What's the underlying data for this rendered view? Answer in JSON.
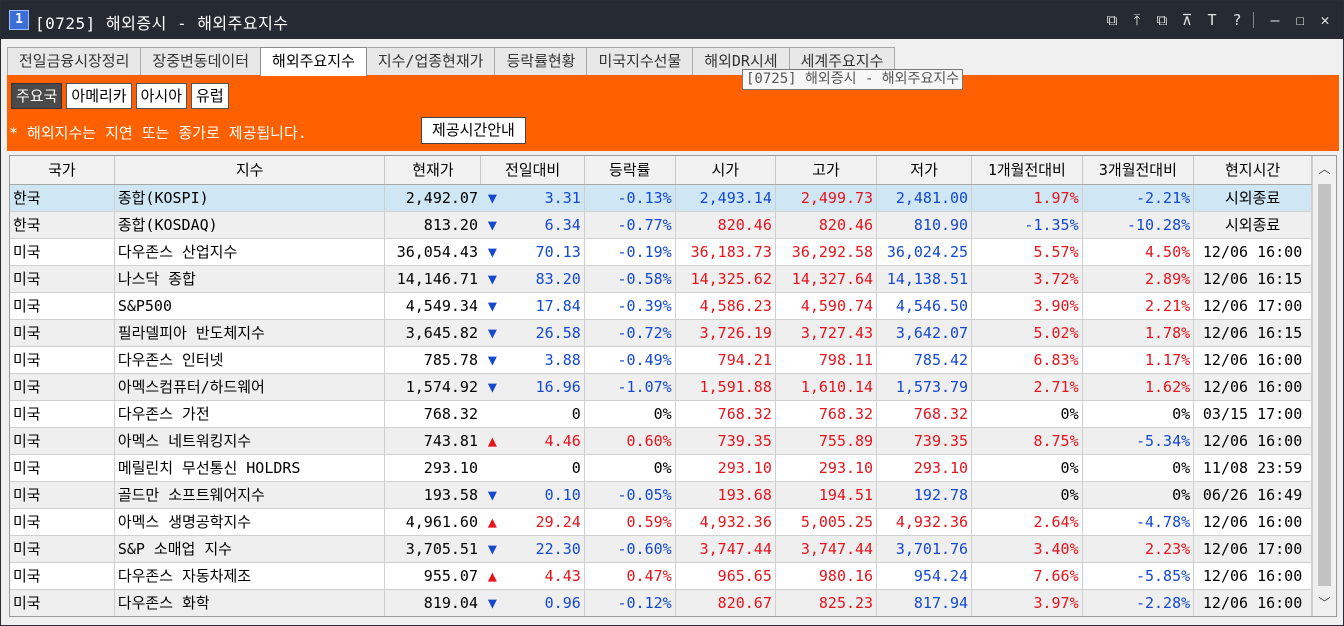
{
  "window": {
    "badge": "1",
    "title": "[0725] 해외증시 - 해외주요지수",
    "tools": [
      "⧉",
      "⤒",
      "⧉",
      "⊼",
      "T",
      "?",
      "—",
      "☐",
      "✕"
    ]
  },
  "tabs": [
    {
      "label": "전일금융시장정리",
      "active": false
    },
    {
      "label": "장중변동데이터",
      "active": false
    },
    {
      "label": "해외주요지수",
      "active": true
    },
    {
      "label": "지수/업종현재가",
      "active": false
    },
    {
      "label": "등락률현황",
      "active": false
    },
    {
      "label": "미국지수선물",
      "active": false
    },
    {
      "label": "해외DR시세",
      "active": false
    },
    {
      "label": "세계주요지수",
      "active": false
    }
  ],
  "tooltip": "[0725] 해외증시 - 해외주요지수",
  "subtabs": [
    {
      "label": "주요국",
      "active": true
    },
    {
      "label": "아메리카",
      "active": false
    },
    {
      "label": "아시아",
      "active": false
    },
    {
      "label": "유럽",
      "active": false
    }
  ],
  "notice": "* 해외지수는 지연 또는 종가로 제공됩니다.",
  "info_button": "제공시간안내",
  "colors": {
    "up": "#e8131b",
    "down": "#1348d1",
    "accent": "#ff6100"
  },
  "table": {
    "headers": [
      "국가",
      "지수",
      "현재가",
      "전일대비",
      "등락률",
      "시가",
      "고가",
      "저가",
      "1개월전대비",
      "3개월전대비",
      "현지시간"
    ],
    "rows": [
      {
        "country": "한국",
        "name": "종합(KOSPI)",
        "price": "2,492.07",
        "dir": "down",
        "change": "3.31",
        "rate": "-0.13%",
        "open": "2,493.14",
        "high": "2,499.73",
        "low": "2,481.00",
        "m1": "1.97%",
        "m3": "-2.21%",
        "time": "시외종료",
        "selected": true,
        "oc": "down",
        "hc": "up",
        "lc": "down",
        "m1c": "up",
        "m3c": "down"
      },
      {
        "country": "한국",
        "name": "종합(KOSDAQ)",
        "price": "813.20",
        "dir": "down",
        "change": "6.34",
        "rate": "-0.77%",
        "open": "820.46",
        "high": "820.46",
        "low": "810.90",
        "m1": "-1.35%",
        "m3": "-10.28%",
        "time": "시외종료",
        "oc": "up",
        "hc": "up",
        "lc": "down",
        "m1c": "down",
        "m3c": "down"
      },
      {
        "country": "미국",
        "name": "다우존스 산업지수",
        "price": "36,054.43",
        "dir": "down",
        "change": "70.13",
        "rate": "-0.19%",
        "open": "36,183.73",
        "high": "36,292.58",
        "low": "36,024.25",
        "m1": "5.57%",
        "m3": "4.50%",
        "time": "12/06 16:00",
        "oc": "up",
        "hc": "up",
        "lc": "down",
        "m1c": "up",
        "m3c": "up"
      },
      {
        "country": "미국",
        "name": "나스닥 종합",
        "price": "14,146.71",
        "dir": "down",
        "change": "83.20",
        "rate": "-0.58%",
        "open": "14,325.62",
        "high": "14,327.64",
        "low": "14,138.51",
        "m1": "3.72%",
        "m3": "2.89%",
        "time": "12/06 16:15",
        "oc": "up",
        "hc": "up",
        "lc": "down",
        "m1c": "up",
        "m3c": "up"
      },
      {
        "country": "미국",
        "name": "S&P500",
        "price": "4,549.34",
        "dir": "down",
        "change": "17.84",
        "rate": "-0.39%",
        "open": "4,586.23",
        "high": "4,590.74",
        "low": "4,546.50",
        "m1": "3.90%",
        "m3": "2.21%",
        "time": "12/06 17:00",
        "oc": "up",
        "hc": "up",
        "lc": "down",
        "m1c": "up",
        "m3c": "up"
      },
      {
        "country": "미국",
        "name": "필라델피아 반도체지수",
        "price": "3,645.82",
        "dir": "down",
        "change": "26.58",
        "rate": "-0.72%",
        "open": "3,726.19",
        "high": "3,727.43",
        "low": "3,642.07",
        "m1": "5.02%",
        "m3": "1.78%",
        "time": "12/06 16:15",
        "oc": "up",
        "hc": "up",
        "lc": "down",
        "m1c": "up",
        "m3c": "up"
      },
      {
        "country": "미국",
        "name": "다우존스 인터넷",
        "price": "785.78",
        "dir": "down",
        "change": "3.88",
        "rate": "-0.49%",
        "open": "794.21",
        "high": "798.11",
        "low": "785.42",
        "m1": "6.83%",
        "m3": "1.17%",
        "time": "12/06 16:00",
        "oc": "up",
        "hc": "up",
        "lc": "down",
        "m1c": "up",
        "m3c": "up"
      },
      {
        "country": "미국",
        "name": "아멕스컴퓨터/하드웨어",
        "price": "1,574.92",
        "dir": "down",
        "change": "16.96",
        "rate": "-1.07%",
        "open": "1,591.88",
        "high": "1,610.14",
        "low": "1,573.79",
        "m1": "2.71%",
        "m3": "1.62%",
        "time": "12/06 16:00",
        "oc": "up",
        "hc": "up",
        "lc": "down",
        "m1c": "up",
        "m3c": "up"
      },
      {
        "country": "미국",
        "name": "다우존스 가전",
        "price": "768.32",
        "dir": "none",
        "change": "0",
        "rate": "0%",
        "open": "768.32",
        "high": "768.32",
        "low": "768.32",
        "m1": "0%",
        "m3": "0%",
        "time": "03/15 17:00",
        "oc": "up",
        "hc": "up",
        "lc": "up",
        "m1c": "black",
        "m3c": "black"
      },
      {
        "country": "미국",
        "name": "아멕스 네트워킹지수",
        "price": "743.81",
        "dir": "up",
        "change": "4.46",
        "rate": "0.60%",
        "open": "739.35",
        "high": "755.89",
        "low": "739.35",
        "m1": "8.75%",
        "m3": "-5.34%",
        "time": "12/06 16:00",
        "oc": "up",
        "hc": "up",
        "lc": "up",
        "m1c": "up",
        "m3c": "down"
      },
      {
        "country": "미국",
        "name": "메릴린치 무선통신 HOLDRS",
        "price": "293.10",
        "dir": "none",
        "change": "0",
        "rate": "0%",
        "open": "293.10",
        "high": "293.10",
        "low": "293.10",
        "m1": "0%",
        "m3": "0%",
        "time": "11/08 23:59",
        "oc": "up",
        "hc": "up",
        "lc": "up",
        "m1c": "black",
        "m3c": "black"
      },
      {
        "country": "미국",
        "name": "골드만 소프트웨어지수",
        "price": "193.58",
        "dir": "down",
        "change": "0.10",
        "rate": "-0.05%",
        "open": "193.68",
        "high": "194.51",
        "low": "192.78",
        "m1": "0%",
        "m3": "0%",
        "time": "06/26 16:49",
        "oc": "up",
        "hc": "up",
        "lc": "down",
        "m1c": "black",
        "m3c": "black"
      },
      {
        "country": "미국",
        "name": "아멕스 생명공학지수",
        "price": "4,961.60",
        "dir": "up",
        "change": "29.24",
        "rate": "0.59%",
        "open": "4,932.36",
        "high": "5,005.25",
        "low": "4,932.36",
        "m1": "2.64%",
        "m3": "-4.78%",
        "time": "12/06 16:00",
        "oc": "up",
        "hc": "up",
        "lc": "up",
        "m1c": "up",
        "m3c": "down"
      },
      {
        "country": "미국",
        "name": "S&P 소매업 지수",
        "price": "3,705.51",
        "dir": "down",
        "change": "22.30",
        "rate": "-0.60%",
        "open": "3,747.44",
        "high": "3,747.44",
        "low": "3,701.76",
        "m1": "3.40%",
        "m3": "2.23%",
        "time": "12/06 17:00",
        "oc": "up",
        "hc": "up",
        "lc": "down",
        "m1c": "up",
        "m3c": "up"
      },
      {
        "country": "미국",
        "name": "다우존스 자동차제조",
        "price": "955.07",
        "dir": "up",
        "change": "4.43",
        "rate": "0.47%",
        "open": "965.65",
        "high": "980.16",
        "low": "954.24",
        "m1": "7.66%",
        "m3": "-5.85%",
        "time": "12/06 16:00",
        "oc": "up",
        "hc": "up",
        "lc": "down",
        "m1c": "up",
        "m3c": "down"
      },
      {
        "country": "미국",
        "name": "다우존스 화학",
        "price": "819.04",
        "dir": "down",
        "change": "0.96",
        "rate": "-0.12%",
        "open": "820.67",
        "high": "825.23",
        "low": "817.94",
        "m1": "3.97%",
        "m3": "-2.28%",
        "time": "12/06 16:00",
        "oc": "up",
        "hc": "up",
        "lc": "down",
        "m1c": "up",
        "m3c": "down"
      }
    ]
  },
  "scroll": {
    "up_arrow": "︿",
    "down_arrow": "﹀"
  }
}
